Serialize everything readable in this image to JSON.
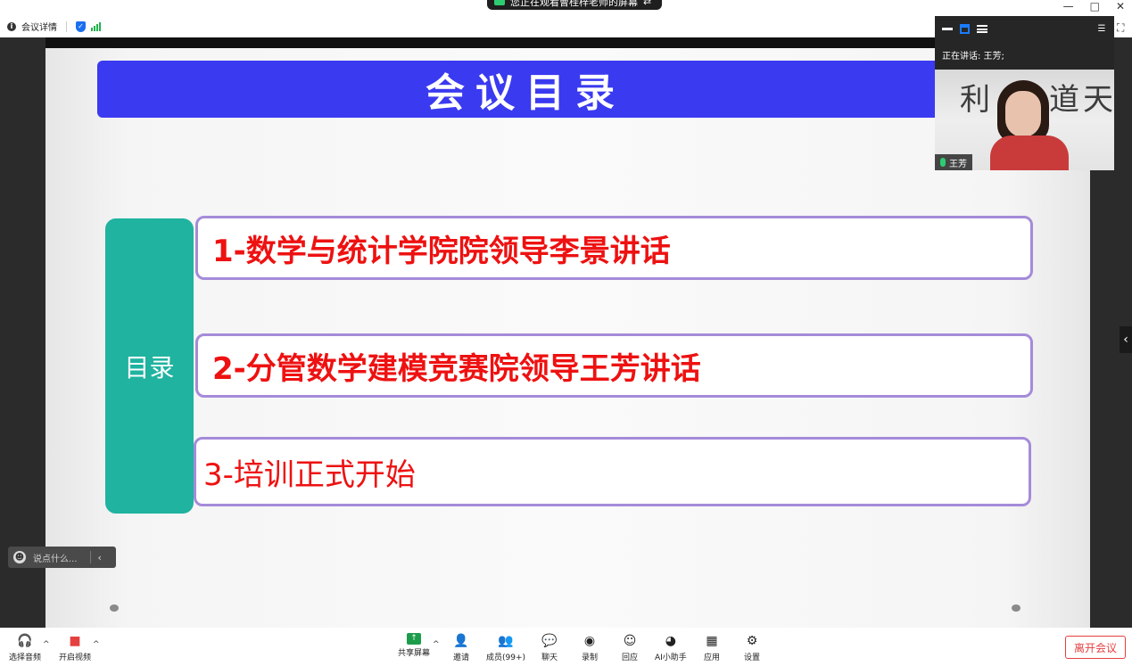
{
  "titlebar": {
    "share_banner": "您正在观看曹桂梓老师的屏幕",
    "meeting_info_label": "会议详情",
    "window_controls": [
      "—",
      "□",
      "✕"
    ]
  },
  "slide": {
    "title": "会议目录",
    "toc_label": "目录",
    "items": [
      "1-数学与统计学院院领导李景讲话",
      "2-分管数学建模竞赛院领导王芳讲话",
      "3-培训正式开始"
    ]
  },
  "chat": {
    "placeholder": "说点什么..."
  },
  "video_panel": {
    "speaking_label": "正在讲话: 王芳;",
    "participant_name": "王芳",
    "calligraphy": [
      "利",
      "道",
      "天"
    ]
  },
  "toolbar": {
    "left": [
      {
        "label": "选择音频",
        "icon": "headphones-icon"
      },
      {
        "label": "开启视频",
        "icon": "video-off-icon"
      }
    ],
    "center": [
      {
        "label": "共享屏幕",
        "icon": "share-screen-icon"
      },
      {
        "label": "邀请",
        "icon": "invite-icon"
      },
      {
        "label": "成员(99+)",
        "icon": "members-icon"
      },
      {
        "label": "聊天",
        "icon": "chat-icon"
      },
      {
        "label": "录制",
        "icon": "record-icon"
      },
      {
        "label": "回应",
        "icon": "reaction-icon"
      },
      {
        "label": "AI小助手",
        "icon": "ai-assistant-icon"
      },
      {
        "label": "应用",
        "icon": "apps-icon"
      },
      {
        "label": "设置",
        "icon": "settings-icon"
      }
    ],
    "leave_label": "离开会议"
  },
  "colors": {
    "title_bar_blue": "#3a3af0",
    "toc_teal": "#1fb3a0",
    "item_text_red": "#ee1111",
    "item_border_purple": "#a58bd9",
    "leave_red": "#e54040",
    "accent_blue": "#1a6ff0"
  }
}
